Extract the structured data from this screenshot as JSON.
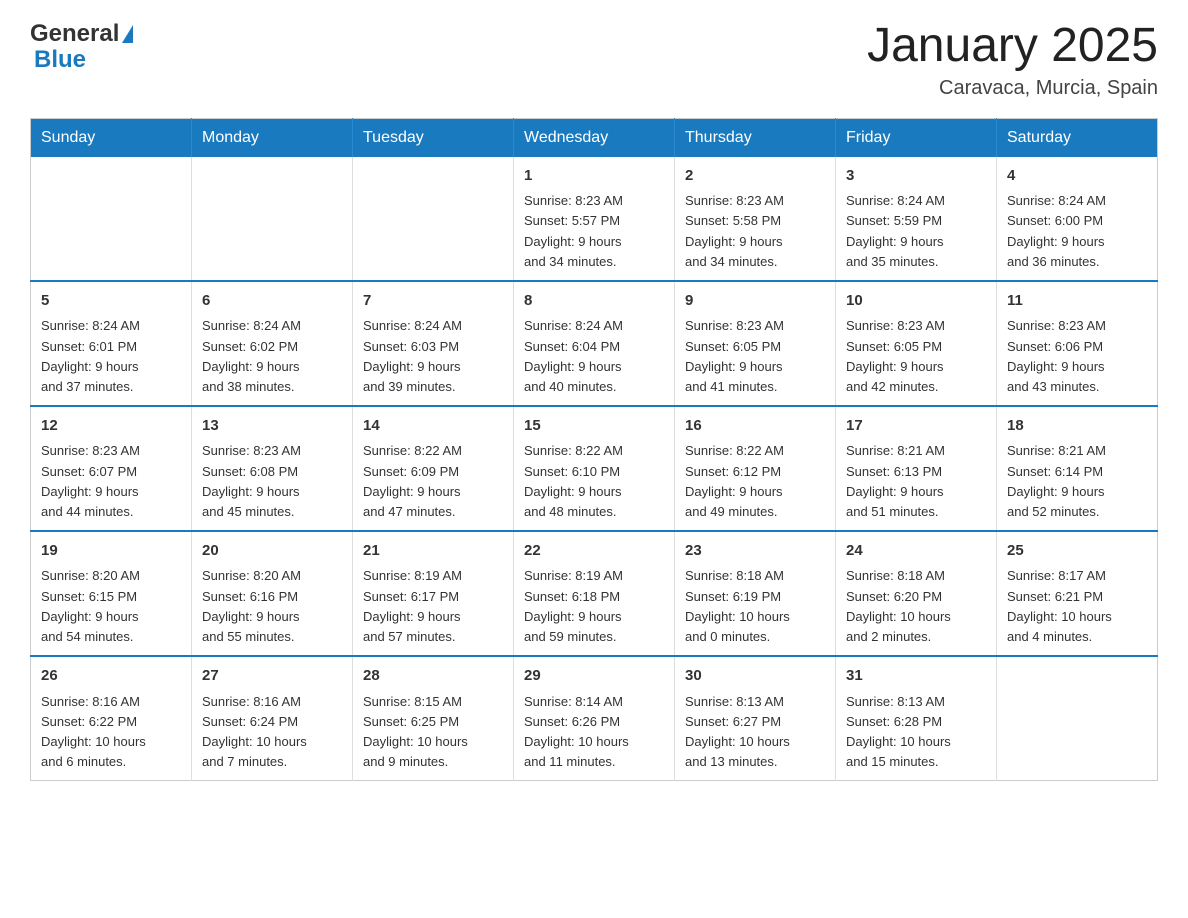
{
  "header": {
    "logo_general": "General",
    "logo_blue": "Blue",
    "calendar_title": "January 2025",
    "calendar_subtitle": "Caravaca, Murcia, Spain"
  },
  "weekdays": [
    "Sunday",
    "Monday",
    "Tuesday",
    "Wednesday",
    "Thursday",
    "Friday",
    "Saturday"
  ],
  "weeks": [
    [
      {
        "day": "",
        "info": ""
      },
      {
        "day": "",
        "info": ""
      },
      {
        "day": "",
        "info": ""
      },
      {
        "day": "1",
        "info": "Sunrise: 8:23 AM\nSunset: 5:57 PM\nDaylight: 9 hours\nand 34 minutes."
      },
      {
        "day": "2",
        "info": "Sunrise: 8:23 AM\nSunset: 5:58 PM\nDaylight: 9 hours\nand 34 minutes."
      },
      {
        "day": "3",
        "info": "Sunrise: 8:24 AM\nSunset: 5:59 PM\nDaylight: 9 hours\nand 35 minutes."
      },
      {
        "day": "4",
        "info": "Sunrise: 8:24 AM\nSunset: 6:00 PM\nDaylight: 9 hours\nand 36 minutes."
      }
    ],
    [
      {
        "day": "5",
        "info": "Sunrise: 8:24 AM\nSunset: 6:01 PM\nDaylight: 9 hours\nand 37 minutes."
      },
      {
        "day": "6",
        "info": "Sunrise: 8:24 AM\nSunset: 6:02 PM\nDaylight: 9 hours\nand 38 minutes."
      },
      {
        "day": "7",
        "info": "Sunrise: 8:24 AM\nSunset: 6:03 PM\nDaylight: 9 hours\nand 39 minutes."
      },
      {
        "day": "8",
        "info": "Sunrise: 8:24 AM\nSunset: 6:04 PM\nDaylight: 9 hours\nand 40 minutes."
      },
      {
        "day": "9",
        "info": "Sunrise: 8:23 AM\nSunset: 6:05 PM\nDaylight: 9 hours\nand 41 minutes."
      },
      {
        "day": "10",
        "info": "Sunrise: 8:23 AM\nSunset: 6:05 PM\nDaylight: 9 hours\nand 42 minutes."
      },
      {
        "day": "11",
        "info": "Sunrise: 8:23 AM\nSunset: 6:06 PM\nDaylight: 9 hours\nand 43 minutes."
      }
    ],
    [
      {
        "day": "12",
        "info": "Sunrise: 8:23 AM\nSunset: 6:07 PM\nDaylight: 9 hours\nand 44 minutes."
      },
      {
        "day": "13",
        "info": "Sunrise: 8:23 AM\nSunset: 6:08 PM\nDaylight: 9 hours\nand 45 minutes."
      },
      {
        "day": "14",
        "info": "Sunrise: 8:22 AM\nSunset: 6:09 PM\nDaylight: 9 hours\nand 47 minutes."
      },
      {
        "day": "15",
        "info": "Sunrise: 8:22 AM\nSunset: 6:10 PM\nDaylight: 9 hours\nand 48 minutes."
      },
      {
        "day": "16",
        "info": "Sunrise: 8:22 AM\nSunset: 6:12 PM\nDaylight: 9 hours\nand 49 minutes."
      },
      {
        "day": "17",
        "info": "Sunrise: 8:21 AM\nSunset: 6:13 PM\nDaylight: 9 hours\nand 51 minutes."
      },
      {
        "day": "18",
        "info": "Sunrise: 8:21 AM\nSunset: 6:14 PM\nDaylight: 9 hours\nand 52 minutes."
      }
    ],
    [
      {
        "day": "19",
        "info": "Sunrise: 8:20 AM\nSunset: 6:15 PM\nDaylight: 9 hours\nand 54 minutes."
      },
      {
        "day": "20",
        "info": "Sunrise: 8:20 AM\nSunset: 6:16 PM\nDaylight: 9 hours\nand 55 minutes."
      },
      {
        "day": "21",
        "info": "Sunrise: 8:19 AM\nSunset: 6:17 PM\nDaylight: 9 hours\nand 57 minutes."
      },
      {
        "day": "22",
        "info": "Sunrise: 8:19 AM\nSunset: 6:18 PM\nDaylight: 9 hours\nand 59 minutes."
      },
      {
        "day": "23",
        "info": "Sunrise: 8:18 AM\nSunset: 6:19 PM\nDaylight: 10 hours\nand 0 minutes."
      },
      {
        "day": "24",
        "info": "Sunrise: 8:18 AM\nSunset: 6:20 PM\nDaylight: 10 hours\nand 2 minutes."
      },
      {
        "day": "25",
        "info": "Sunrise: 8:17 AM\nSunset: 6:21 PM\nDaylight: 10 hours\nand 4 minutes."
      }
    ],
    [
      {
        "day": "26",
        "info": "Sunrise: 8:16 AM\nSunset: 6:22 PM\nDaylight: 10 hours\nand 6 minutes."
      },
      {
        "day": "27",
        "info": "Sunrise: 8:16 AM\nSunset: 6:24 PM\nDaylight: 10 hours\nand 7 minutes."
      },
      {
        "day": "28",
        "info": "Sunrise: 8:15 AM\nSunset: 6:25 PM\nDaylight: 10 hours\nand 9 minutes."
      },
      {
        "day": "29",
        "info": "Sunrise: 8:14 AM\nSunset: 6:26 PM\nDaylight: 10 hours\nand 11 minutes."
      },
      {
        "day": "30",
        "info": "Sunrise: 8:13 AM\nSunset: 6:27 PM\nDaylight: 10 hours\nand 13 minutes."
      },
      {
        "day": "31",
        "info": "Sunrise: 8:13 AM\nSunset: 6:28 PM\nDaylight: 10 hours\nand 15 minutes."
      },
      {
        "day": "",
        "info": ""
      }
    ]
  ]
}
